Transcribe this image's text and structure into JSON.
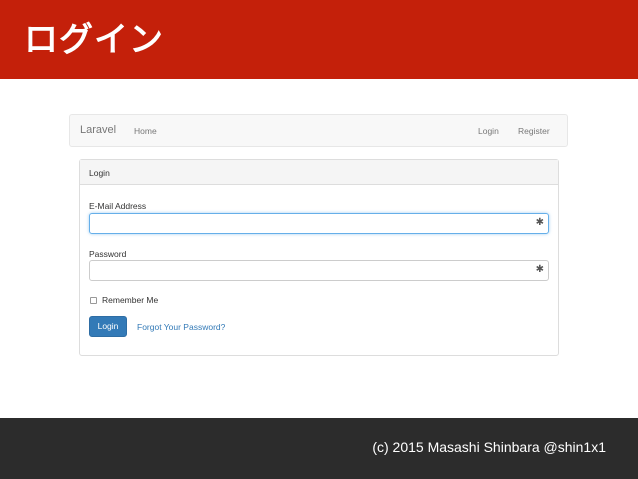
{
  "slide": {
    "title": "ログイン",
    "footer": "(c) 2015 Masashi Shinbara @shin1x1"
  },
  "navbar": {
    "brand": "Laravel",
    "home": "Home",
    "login": "Login",
    "register": "Register"
  },
  "panel": {
    "heading": "Login",
    "email_label": "E-Mail Address",
    "email_value": "",
    "password_label": "Password",
    "password_value": "",
    "required_marker": "✱",
    "remember_label": "Remember Me",
    "remember_checked": false,
    "login_button": "Login",
    "forgot_link": "Forgot Your Password?"
  },
  "colors": {
    "header_red": "#c4200a",
    "footer_dark": "#2c2c2c",
    "primary_blue": "#337ab7"
  }
}
